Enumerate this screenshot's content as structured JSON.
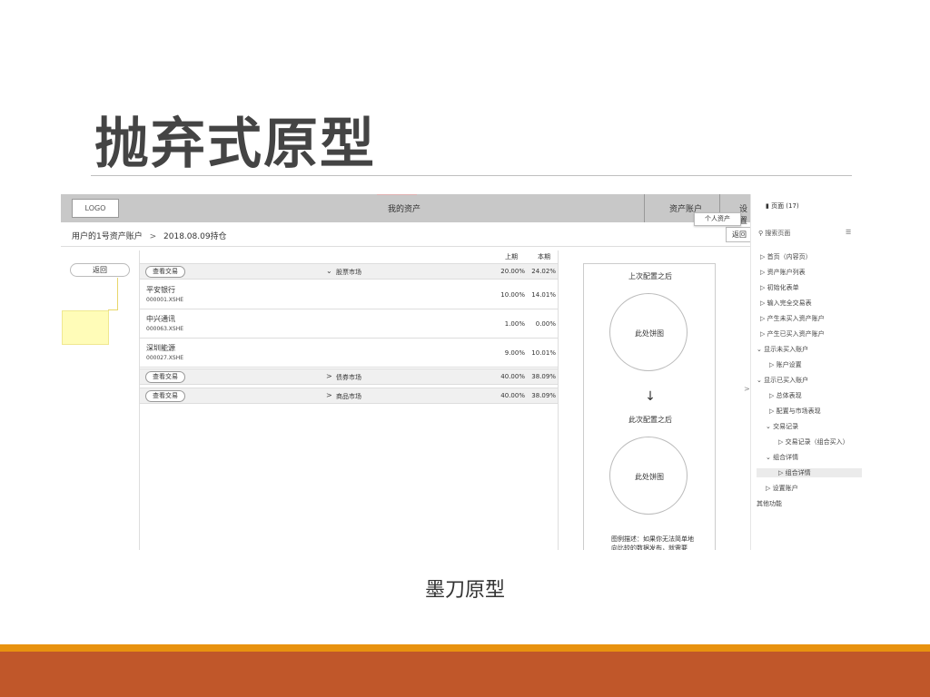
{
  "slide": {
    "title": "抛弃式原型",
    "caption": "墨刀原型"
  },
  "prototype": {
    "topbar": {
      "logo": "LOGO",
      "title": "我的资产",
      "account_menu": "资产账户",
      "account_menu2": "设置",
      "tooltip": "个人资产"
    },
    "breadcrumb": {
      "account": "用户的1号资产账户",
      "date": "2018.08.09持仓",
      "back": "返回"
    },
    "back_pill": "返回",
    "columns": {
      "c1": "上期",
      "c2": "本期"
    },
    "groups": [
      {
        "btn": "查看交易",
        "name": "股票市场",
        "v1": "20.00%",
        "v2": "24.02%",
        "expanded": true
      },
      {
        "btn": "查看交易",
        "name": "债券市场",
        "v1": "40.00%",
        "v2": "38.09%",
        "expanded": false
      },
      {
        "btn": "查看交易",
        "name": "商品市场",
        "v1": "40.00%",
        "v2": "38.09%",
        "expanded": false
      }
    ],
    "stocks": [
      {
        "name": "平安银行",
        "code": "000001.XSHE",
        "v1": "10.00%",
        "v2": "14.01%"
      },
      {
        "name": "中兴通讯",
        "code": "000063.XSHE",
        "v1": "1.00%",
        "v2": "0.00%"
      },
      {
        "name": "深圳能源",
        "code": "000027.XSHE",
        "v1": "9.00%",
        "v2": "10.01%"
      }
    ],
    "right_panel": {
      "before_label": "上次配置之后",
      "circle1": "此处饼图",
      "arrow": "↓",
      "after_label": "此次配置之后",
      "circle2": "此处饼图",
      "note": "图例描述：如果你无法简单地向比较的数据发布，就需要"
    }
  },
  "pages_panel": {
    "header": "页面 (17)",
    "search_placeholder": "搜索页面",
    "items": [
      "首页（内容页）",
      "资产账户列表",
      "初始化表单",
      "输入完全交易表",
      "产生未买入资产账户",
      "产生已买入资产账户",
      "显示未买入账户",
      "账户设置",
      "显示已买入账户",
      "总体表现",
      "配置与市场表现",
      "交易记录",
      "交易记录（组合买入）",
      "组合详情",
      "组合详情",
      "设置账户",
      "其他功能"
    ]
  }
}
